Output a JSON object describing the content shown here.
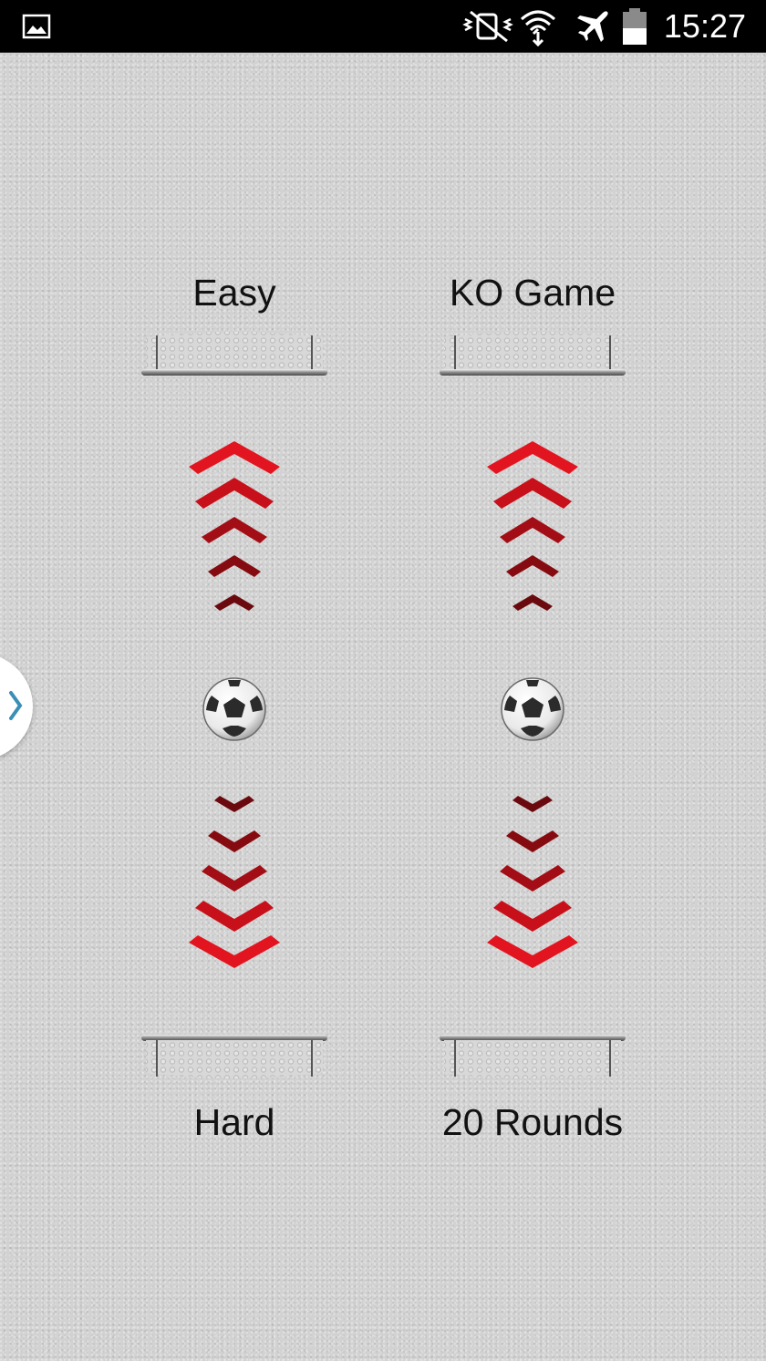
{
  "status_bar": {
    "time": "15:27",
    "icons": [
      "gallery-icon",
      "vibrate-mute-icon",
      "wifi-icon",
      "airplane-mode-icon",
      "battery-icon"
    ]
  },
  "left_column": {
    "top_option": "Easy",
    "bottom_option": "Hard"
  },
  "right_column": {
    "top_option": "KO Game",
    "bottom_option": "20 Rounds"
  },
  "colors": {
    "chevron_bright": "#e2141f",
    "chevron_dark": "#6b0a0e",
    "status_bar": "#000000",
    "background": "#d2d2d2",
    "drawer_arrow": "#3a8fb7"
  }
}
